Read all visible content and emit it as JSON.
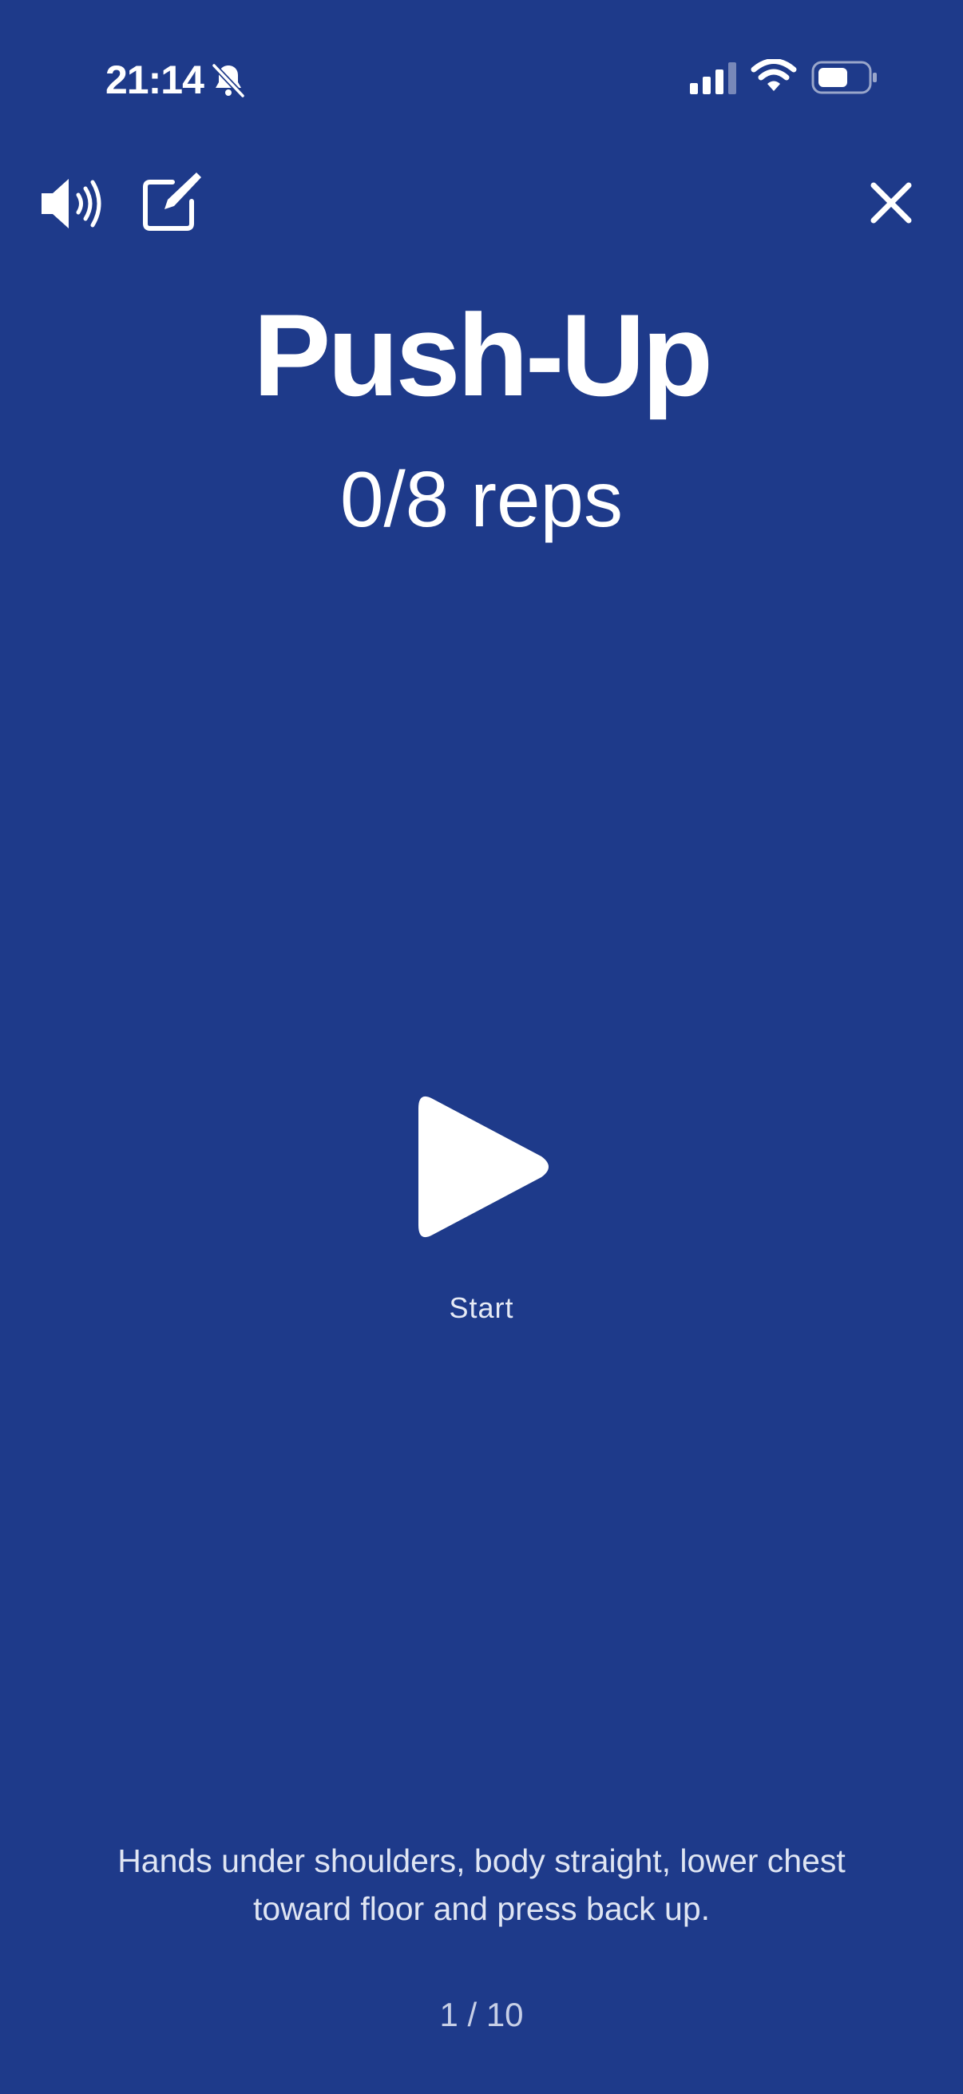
{
  "status_bar": {
    "time": "21:14",
    "icons": [
      "bell-slash-icon",
      "cellular-signal-icon",
      "wifi-icon",
      "battery-icon"
    ]
  },
  "toolbar": {
    "icons": [
      "speaker-icon",
      "edit-icon",
      "close-icon"
    ]
  },
  "exercise": {
    "title": "Push-Up",
    "reps": "0/8 reps",
    "instructions": "Hands under shoulders, body straight, lower chest toward floor and press back up."
  },
  "controls": {
    "start_label": "Start",
    "play_icon": "play-icon"
  },
  "progress": {
    "indicator": "1 / 10"
  },
  "colors": {
    "background": "#1e3a8a",
    "foreground": "#ffffff"
  }
}
